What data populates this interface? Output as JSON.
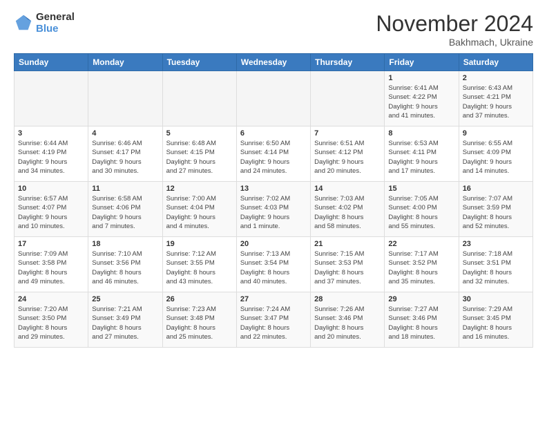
{
  "header": {
    "logo_line1": "General",
    "logo_line2": "Blue",
    "title": "November 2024",
    "subtitle": "Bakhmach, Ukraine"
  },
  "weekdays": [
    "Sunday",
    "Monday",
    "Tuesday",
    "Wednesday",
    "Thursday",
    "Friday",
    "Saturday"
  ],
  "weeks": [
    [
      {
        "day": "",
        "info": ""
      },
      {
        "day": "",
        "info": ""
      },
      {
        "day": "",
        "info": ""
      },
      {
        "day": "",
        "info": ""
      },
      {
        "day": "",
        "info": ""
      },
      {
        "day": "1",
        "info": "Sunrise: 6:41 AM\nSunset: 4:22 PM\nDaylight: 9 hours\nand 41 minutes."
      },
      {
        "day": "2",
        "info": "Sunrise: 6:43 AM\nSunset: 4:21 PM\nDaylight: 9 hours\nand 37 minutes."
      }
    ],
    [
      {
        "day": "3",
        "info": "Sunrise: 6:44 AM\nSunset: 4:19 PM\nDaylight: 9 hours\nand 34 minutes."
      },
      {
        "day": "4",
        "info": "Sunrise: 6:46 AM\nSunset: 4:17 PM\nDaylight: 9 hours\nand 30 minutes."
      },
      {
        "day": "5",
        "info": "Sunrise: 6:48 AM\nSunset: 4:15 PM\nDaylight: 9 hours\nand 27 minutes."
      },
      {
        "day": "6",
        "info": "Sunrise: 6:50 AM\nSunset: 4:14 PM\nDaylight: 9 hours\nand 24 minutes."
      },
      {
        "day": "7",
        "info": "Sunrise: 6:51 AM\nSunset: 4:12 PM\nDaylight: 9 hours\nand 20 minutes."
      },
      {
        "day": "8",
        "info": "Sunrise: 6:53 AM\nSunset: 4:11 PM\nDaylight: 9 hours\nand 17 minutes."
      },
      {
        "day": "9",
        "info": "Sunrise: 6:55 AM\nSunset: 4:09 PM\nDaylight: 9 hours\nand 14 minutes."
      }
    ],
    [
      {
        "day": "10",
        "info": "Sunrise: 6:57 AM\nSunset: 4:07 PM\nDaylight: 9 hours\nand 10 minutes."
      },
      {
        "day": "11",
        "info": "Sunrise: 6:58 AM\nSunset: 4:06 PM\nDaylight: 9 hours\nand 7 minutes."
      },
      {
        "day": "12",
        "info": "Sunrise: 7:00 AM\nSunset: 4:04 PM\nDaylight: 9 hours\nand 4 minutes."
      },
      {
        "day": "13",
        "info": "Sunrise: 7:02 AM\nSunset: 4:03 PM\nDaylight: 9 hours\nand 1 minute."
      },
      {
        "day": "14",
        "info": "Sunrise: 7:03 AM\nSunset: 4:02 PM\nDaylight: 8 hours\nand 58 minutes."
      },
      {
        "day": "15",
        "info": "Sunrise: 7:05 AM\nSunset: 4:00 PM\nDaylight: 8 hours\nand 55 minutes."
      },
      {
        "day": "16",
        "info": "Sunrise: 7:07 AM\nSunset: 3:59 PM\nDaylight: 8 hours\nand 52 minutes."
      }
    ],
    [
      {
        "day": "17",
        "info": "Sunrise: 7:09 AM\nSunset: 3:58 PM\nDaylight: 8 hours\nand 49 minutes."
      },
      {
        "day": "18",
        "info": "Sunrise: 7:10 AM\nSunset: 3:56 PM\nDaylight: 8 hours\nand 46 minutes."
      },
      {
        "day": "19",
        "info": "Sunrise: 7:12 AM\nSunset: 3:55 PM\nDaylight: 8 hours\nand 43 minutes."
      },
      {
        "day": "20",
        "info": "Sunrise: 7:13 AM\nSunset: 3:54 PM\nDaylight: 8 hours\nand 40 minutes."
      },
      {
        "day": "21",
        "info": "Sunrise: 7:15 AM\nSunset: 3:53 PM\nDaylight: 8 hours\nand 37 minutes."
      },
      {
        "day": "22",
        "info": "Sunrise: 7:17 AM\nSunset: 3:52 PM\nDaylight: 8 hours\nand 35 minutes."
      },
      {
        "day": "23",
        "info": "Sunrise: 7:18 AM\nSunset: 3:51 PM\nDaylight: 8 hours\nand 32 minutes."
      }
    ],
    [
      {
        "day": "24",
        "info": "Sunrise: 7:20 AM\nSunset: 3:50 PM\nDaylight: 8 hours\nand 29 minutes."
      },
      {
        "day": "25",
        "info": "Sunrise: 7:21 AM\nSunset: 3:49 PM\nDaylight: 8 hours\nand 27 minutes."
      },
      {
        "day": "26",
        "info": "Sunrise: 7:23 AM\nSunset: 3:48 PM\nDaylight: 8 hours\nand 25 minutes."
      },
      {
        "day": "27",
        "info": "Sunrise: 7:24 AM\nSunset: 3:47 PM\nDaylight: 8 hours\nand 22 minutes."
      },
      {
        "day": "28",
        "info": "Sunrise: 7:26 AM\nSunset: 3:46 PM\nDaylight: 8 hours\nand 20 minutes."
      },
      {
        "day": "29",
        "info": "Sunrise: 7:27 AM\nSunset: 3:46 PM\nDaylight: 8 hours\nand 18 minutes."
      },
      {
        "day": "30",
        "info": "Sunrise: 7:29 AM\nSunset: 3:45 PM\nDaylight: 8 hours\nand 16 minutes."
      }
    ]
  ]
}
